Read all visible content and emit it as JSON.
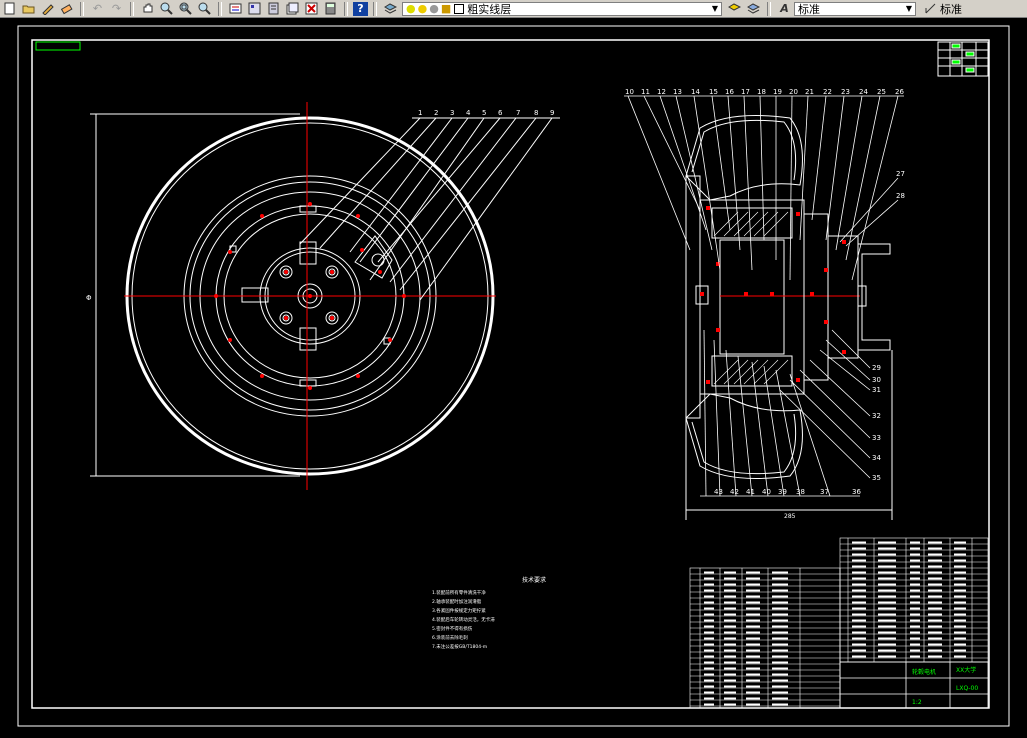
{
  "toolbar": {
    "icons": [
      "new-icon",
      "open-icon",
      "pencil-icon",
      "eraser-icon",
      "undo-icon",
      "redo-icon",
      "pan-icon",
      "zoom-realtime-icon",
      "zoom-window-icon",
      "zoom-previous-icon",
      "properties-icon",
      "design-center-icon",
      "tool-palette-icon",
      "sheet-set-icon",
      "markup-icon",
      "calculator-icon",
      "help-icon",
      "layer-icon",
      "lightbulb-icon",
      "sun-icon",
      "freeze-icon",
      "lock-icon",
      "color-square-icon"
    ],
    "layer_name": "粗实线层",
    "layer_state_icon": "layer-state-icon",
    "text_style_label": "标准",
    "dim_style_label": "标准",
    "help_glyph": "?",
    "undo_glyph": "↶",
    "redo_glyph": "↷"
  },
  "drawing": {
    "left_labels": [
      "1",
      "2",
      "3",
      "4",
      "5",
      "6",
      "7",
      "8",
      "9"
    ],
    "right_top_labels": [
      "10",
      "11",
      "12",
      "13",
      "14",
      "15",
      "16",
      "17",
      "18",
      "19",
      "20",
      "21",
      "22",
      "23",
      "24",
      "25",
      "26"
    ],
    "right_side_labels": [
      "27",
      "28",
      "29",
      "30",
      "31",
      "32",
      "33",
      "34",
      "35"
    ],
    "bottom_labels": [
      "43",
      "42",
      "41",
      "40",
      "39",
      "38",
      "37",
      "36"
    ],
    "tech_req_title": "技术要求",
    "tech_req_lines": [
      "1.装配前所有零件清洗干净",
      "2.轴承装配时加注润滑脂",
      "3.各紧固件按规定力矩拧紧",
      "4.装配后车轮转动灵活，无卡滞",
      "5.密封件不得有损伤",
      "6.涂装前去除毛刺",
      "7.未注公差按GB/T1804-m"
    ],
    "title_block": {
      "company": "XX大学",
      "drawing_no": "LXQ-00",
      "name": "轮毂电机",
      "scale": "1:2"
    },
    "dim_left": "Φ",
    "dim_bottom": "285"
  },
  "colors": {
    "background": "#000000",
    "line": "#ffffff",
    "center": "#ff0000",
    "green": "#00ff00",
    "cyan": "#00ffff",
    "yellow": "#ffff00"
  }
}
